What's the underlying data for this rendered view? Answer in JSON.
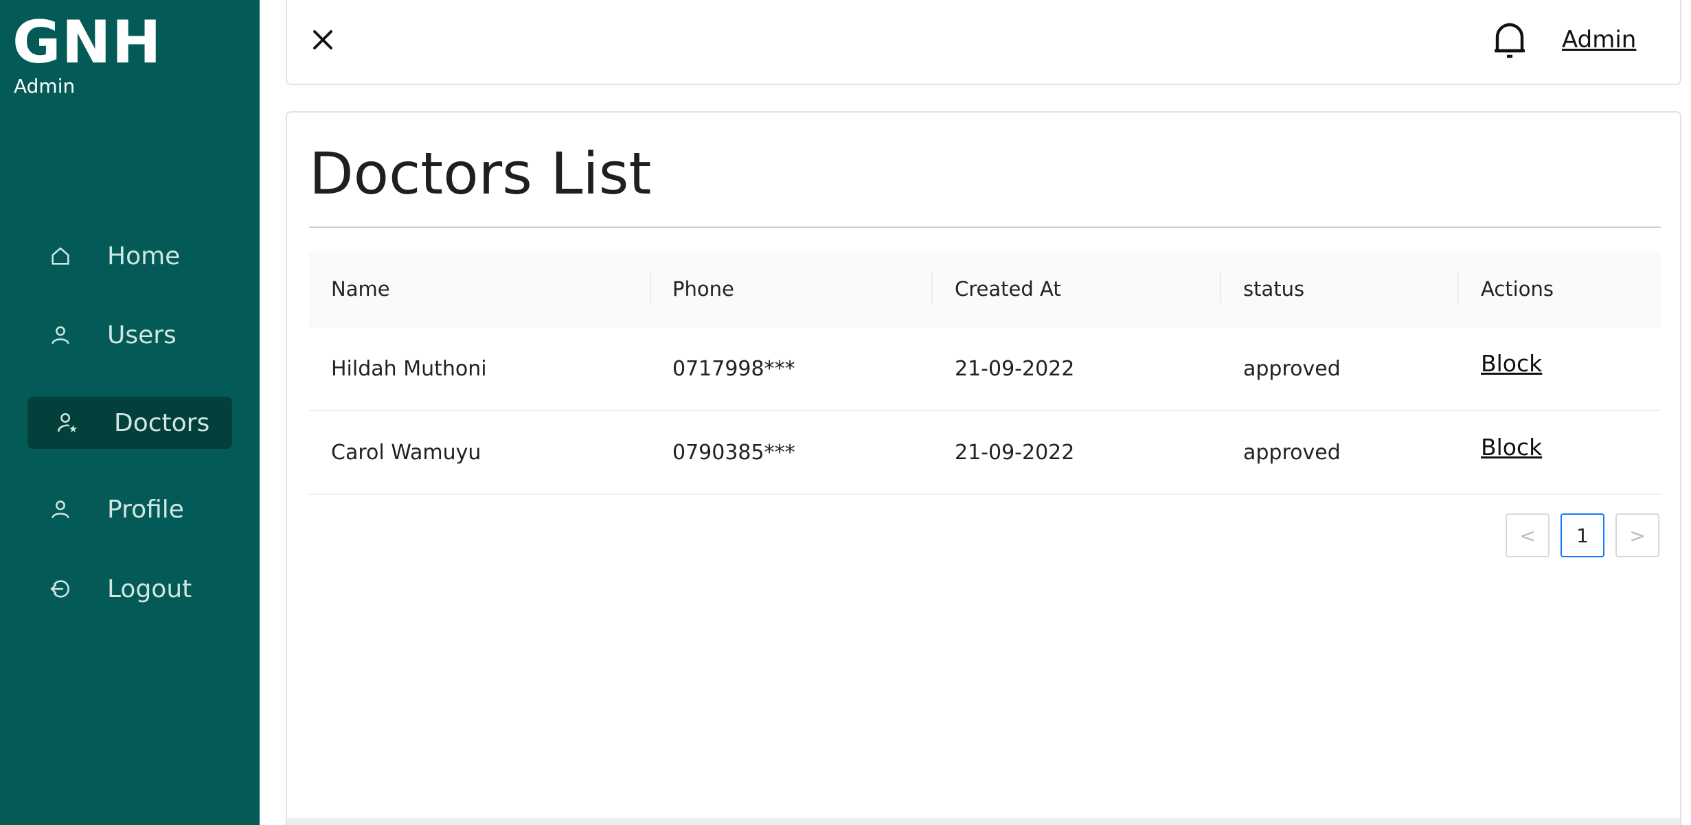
{
  "brand": {
    "title": "GNH",
    "subtitle": "Admin"
  },
  "sidebar": {
    "items": [
      {
        "label": "Home",
        "icon": "home-icon"
      },
      {
        "label": "Users",
        "icon": "user-icon"
      },
      {
        "label": "Doctors",
        "icon": "user-star-icon",
        "active": true
      },
      {
        "label": "Profile",
        "icon": "user-icon"
      },
      {
        "label": "Logout",
        "icon": "logout-icon"
      }
    ]
  },
  "header": {
    "close_icon": "close-icon",
    "bell_icon": "bell-icon",
    "user_link": "Admin"
  },
  "main": {
    "title": "Doctors List",
    "table": {
      "columns": [
        "Name",
        "Phone",
        "Created At",
        "status",
        "Actions"
      ],
      "rows": [
        {
          "name": "Hildah Muthoni",
          "phone": "0717998***",
          "created_at": "21-09-2022",
          "status": "approved",
          "action": "Block"
        },
        {
          "name": "Carol Wamuyu",
          "phone": "0790385***",
          "created_at": "21-09-2022",
          "status": "approved",
          "action": "Block"
        }
      ]
    },
    "pagination": {
      "prev": "<",
      "current": "1",
      "next": ">"
    }
  },
  "colors": {
    "sidebar_bg": "#035a56",
    "sidebar_active_bg": "#033f3b",
    "accent": "#1677ff"
  }
}
